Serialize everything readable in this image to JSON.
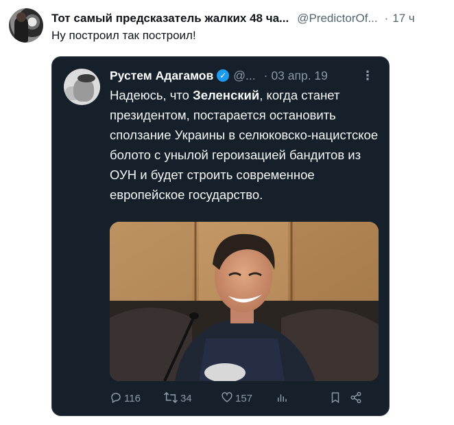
{
  "outer_tweet": {
    "author_name": "Тот самый предсказатель жалких 48 ча...",
    "handle": "@PredictorOf...",
    "separator": "·",
    "time": "17 ч",
    "text": "Ну построил так построил!"
  },
  "quoted_tweet": {
    "author_name": "Рустем Адагамов",
    "verified_mark": "✓",
    "handle": "@...",
    "separator": "·",
    "date": "03 апр. 19",
    "more_menu": "⋮",
    "text_before": "Надеюсь, что ",
    "text_bold": "Зеленский",
    "text_after": ", когда станет президентом, постарается остановить сползание Украины в селюковско-нацистское болото с унылой героизацией бандитов из ОУН и будет строить современное европейское государство.",
    "actions": {
      "reply_icon": "reply-icon",
      "reply_count": "116",
      "retweet_icon": "retweet-icon",
      "retweet_count": "34",
      "like_icon": "heart-icon",
      "like_count": "157",
      "views_icon": "bar-chart-icon",
      "bookmark_icon": "bookmark-icon",
      "share_icon": "share-icon"
    }
  },
  "colors": {
    "card_background": "#15202b",
    "verified_blue": "#1d9bf0",
    "muted_text": "#8b98a5",
    "outer_muted_text": "#536471"
  }
}
